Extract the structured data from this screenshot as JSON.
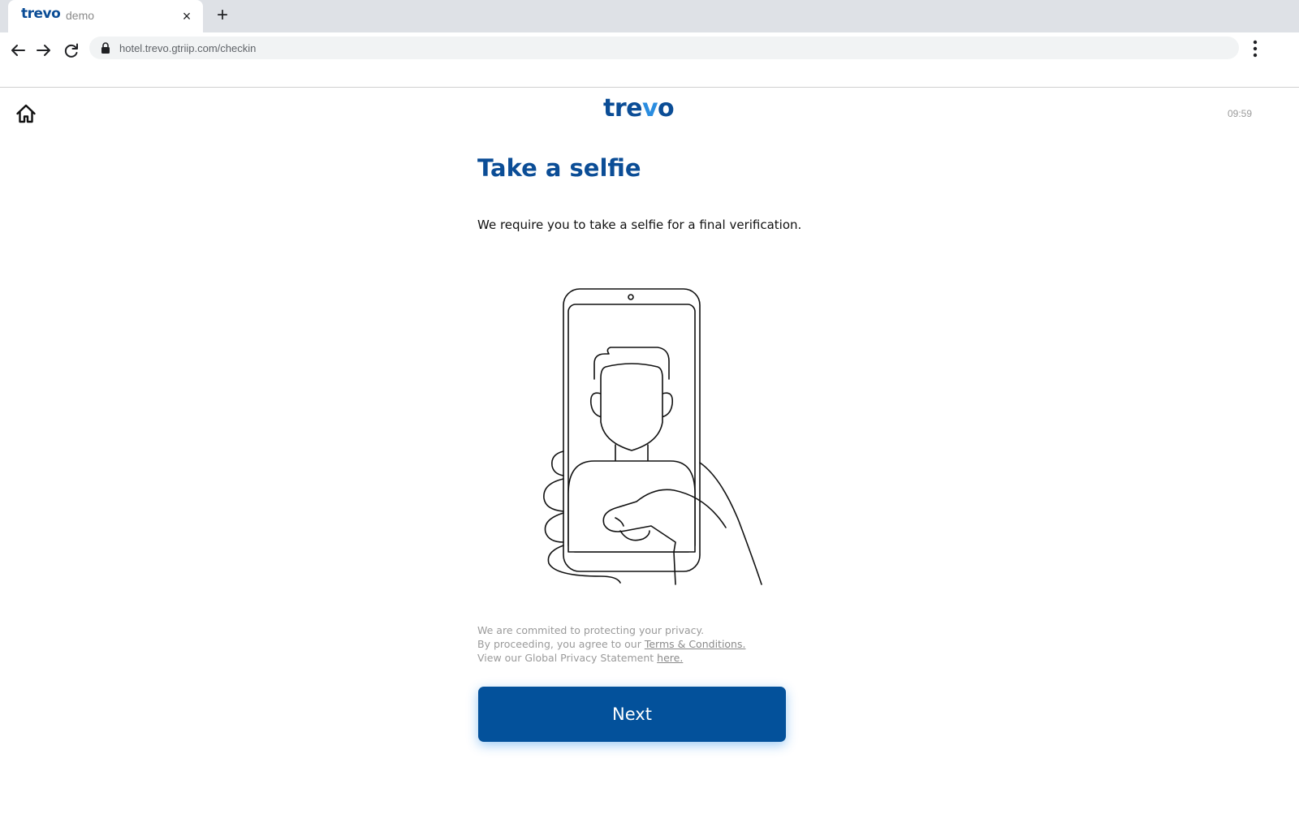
{
  "browser": {
    "tab": {
      "logo": "trevo",
      "title": "demo",
      "close": "×"
    },
    "new_tab": "+",
    "url": "hotel.trevo.gtriip.com/checkin"
  },
  "header": {
    "logo_main": "tre",
    "logo_v": "v",
    "logo_end": "o",
    "clock": "09:59"
  },
  "main": {
    "title": "Take a selfie",
    "description": "We require you to take a selfie for a final verification.",
    "privacy": {
      "line1": "We are commited to protecting your privacy.",
      "line2_prefix": "By proceeding, you agree to our ",
      "terms_link": "Terms & Conditions.",
      "line3_prefix": "View our Global Privacy Statement ",
      "here_link": "here."
    },
    "next_button": "Next"
  },
  "colors": {
    "brand": "#0b4d96",
    "accent": "#2a8de0",
    "button": "#03519b"
  },
  "icons": [
    "back-arrow-icon",
    "forward-arrow-icon",
    "reload-icon",
    "lock-icon",
    "kebab-menu-icon",
    "home-icon"
  ]
}
